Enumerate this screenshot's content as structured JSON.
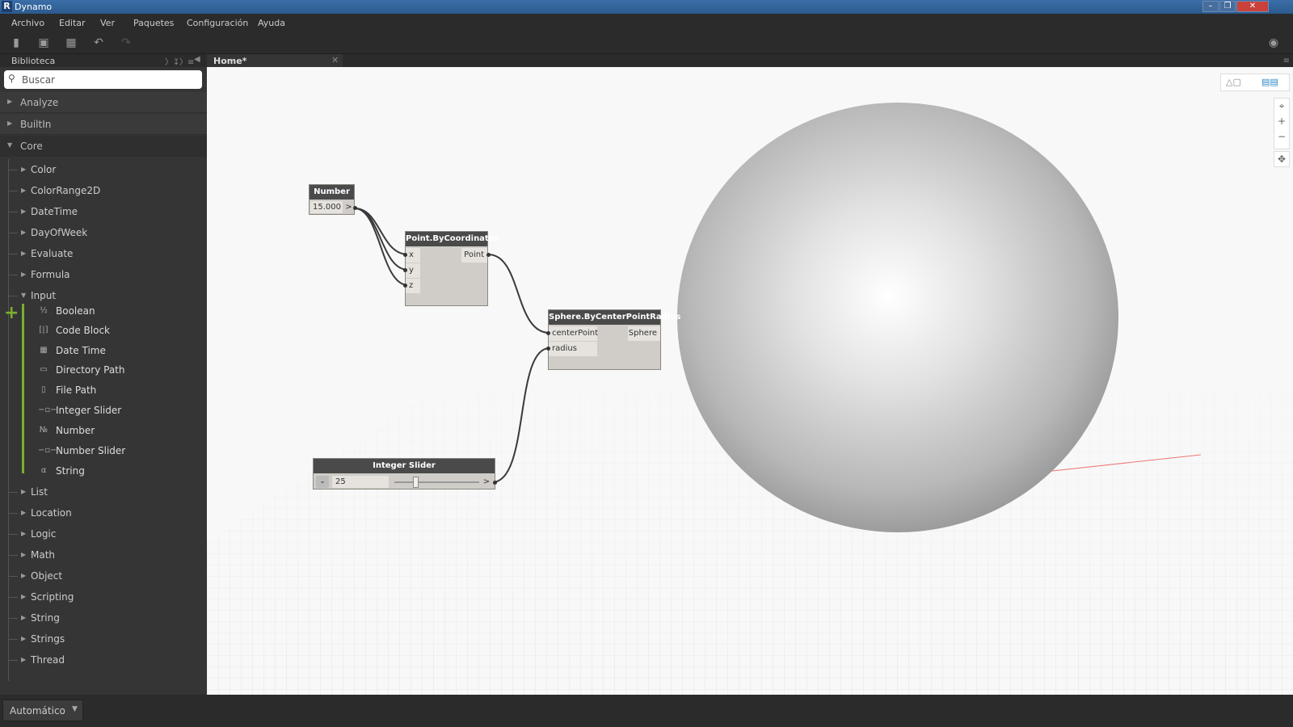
{
  "window": {
    "title": "Dynamo",
    "logo": "R"
  },
  "menu": [
    "Archivo",
    "Editar",
    "Ver",
    "Paquetes",
    "Configuración",
    "Ayuda"
  ],
  "toolbar_icons": [
    "new-file-icon",
    "open-icon",
    "save-icon",
    "undo-icon",
    "redo-icon",
    "camera-icon"
  ],
  "library": {
    "header": "Biblioteca",
    "search_placeholder": "Buscar",
    "top_categories": [
      "Analyze",
      "BuiltIn",
      "Core"
    ],
    "core_items": [
      "Color",
      "ColorRange2D",
      "DateTime",
      "DayOfWeek",
      "Evaluate",
      "Formula",
      "Input"
    ],
    "input_nodes": [
      "Boolean",
      "Code Block",
      "Date Time",
      "Directory Path",
      "File Path",
      "Integer Slider",
      "Number",
      "Number Slider",
      "String"
    ],
    "more_items": [
      "List",
      "Location",
      "Logic",
      "Math",
      "Object",
      "Scripting",
      "String",
      "Strings",
      "Thread"
    ]
  },
  "tab": {
    "label": "Home*"
  },
  "run_mode": "Automático",
  "nodes": {
    "number": {
      "title": "Number",
      "value": "15.000",
      "arrow": ">"
    },
    "point": {
      "title": "Point.ByCoordinates",
      "inputs": [
        "x",
        "y",
        "z"
      ],
      "output": "Point"
    },
    "sphere": {
      "title": "Sphere.ByCenterPointRadius",
      "inputs": [
        "centerPoint",
        "radius"
      ],
      "output": "Sphere"
    },
    "slider": {
      "title": "Integer Slider",
      "value": "25",
      "arrow": ">",
      "slider_fraction": 0.25
    }
  },
  "colors": {
    "accent": "#7ab02c",
    "node_header": "#4a4a4a",
    "view_toggle": "#2a87c8"
  }
}
